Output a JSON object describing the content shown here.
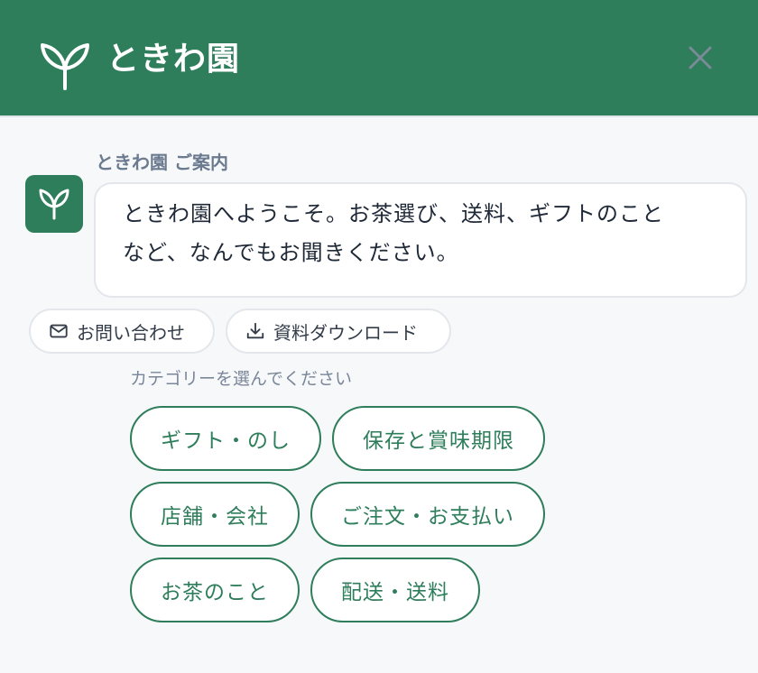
{
  "header": {
    "brand": "ときわ園",
    "logo_icon": "leaf-sprout-icon",
    "close_icon": "close-icon",
    "background": "#2e7d5b"
  },
  "chat": {
    "bot_name": "ときわ園 ご案内",
    "avatar_icon": "leaf-sprout-icon",
    "message_line1": "ときわ園へようこそ。お茶選び、送料、ギフトのこと",
    "message_line2": "など、なんでもお聞きください。"
  },
  "quick_actions": [
    {
      "label": "お問い合わせ",
      "icon": "mail-icon"
    },
    {
      "label": "資料ダウンロード",
      "icon": "download-icon"
    }
  ],
  "category_prompt": "カテゴリーを選んでください",
  "categories": [
    {
      "label": "ギフト・のし"
    },
    {
      "label": "保存と賞味期限"
    },
    {
      "label": "店舗・会社"
    },
    {
      "label": "ご注文・お支払い"
    },
    {
      "label": "お茶のこと"
    },
    {
      "label": "配送・送料"
    }
  ]
}
